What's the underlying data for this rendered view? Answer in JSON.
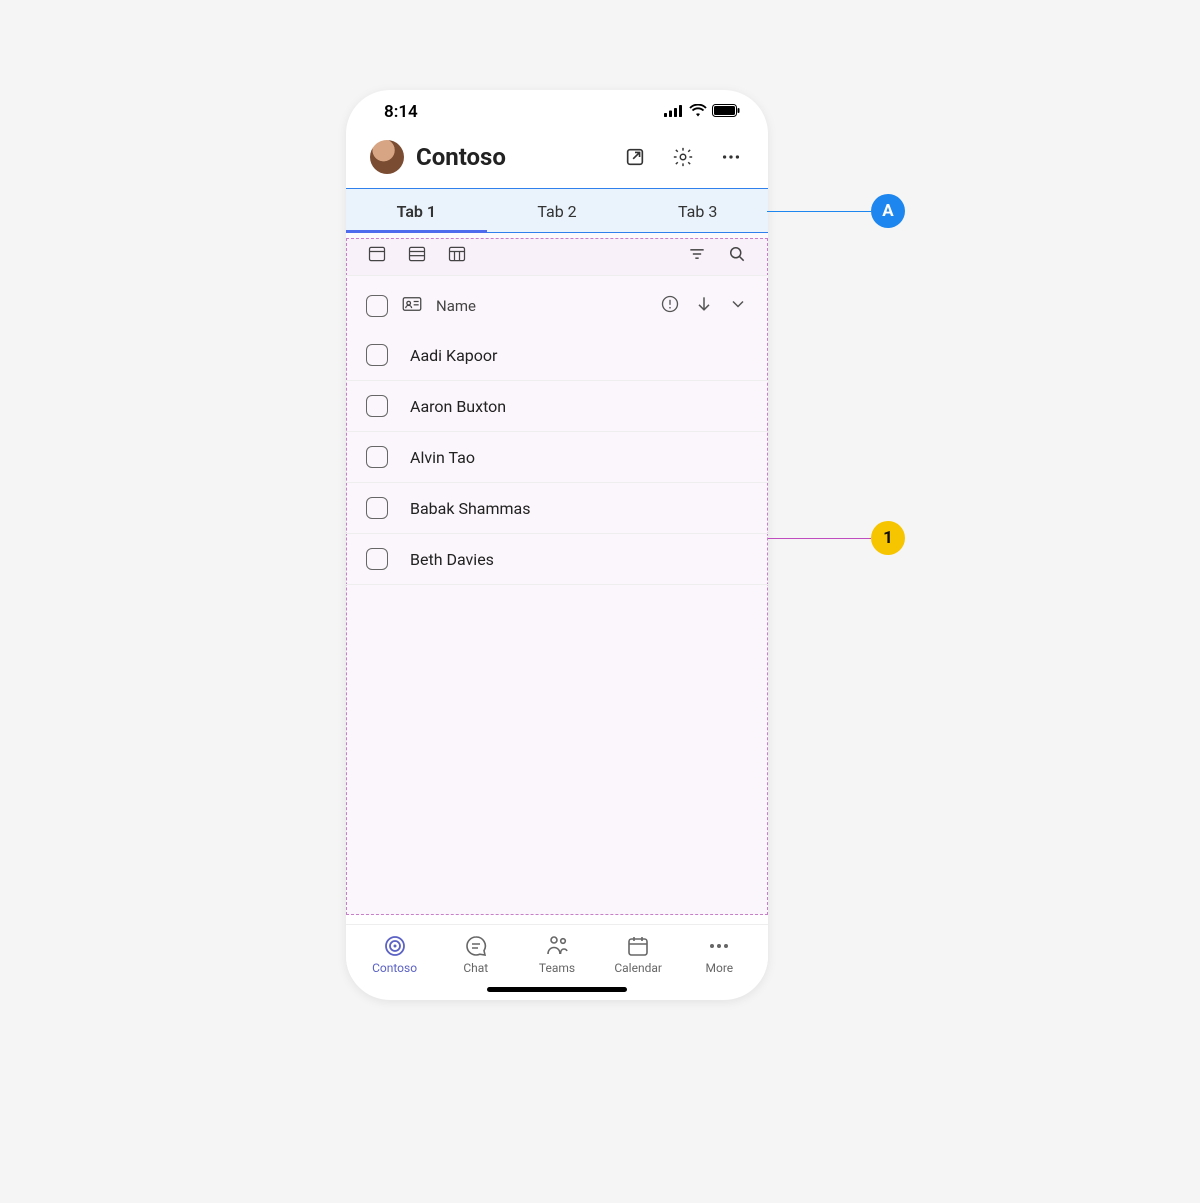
{
  "statusbar": {
    "time": "8:14"
  },
  "header": {
    "title": "Contoso"
  },
  "tabs": {
    "items": [
      "Tab 1",
      "Tab 2",
      "Tab 3"
    ],
    "activeIndex": 0
  },
  "list": {
    "headerLabel": "Name",
    "rows": [
      {
        "name": "Aadi Kapoor"
      },
      {
        "name": "Aaron Buxton"
      },
      {
        "name": "Alvin Tao"
      },
      {
        "name": "Babak Shammas"
      },
      {
        "name": "Beth Davies"
      }
    ]
  },
  "bottomNav": {
    "items": [
      {
        "label": "Contoso"
      },
      {
        "label": "Chat"
      },
      {
        "label": "Teams"
      },
      {
        "label": "Calendar"
      },
      {
        "label": "More"
      }
    ],
    "activeIndex": 0
  },
  "callouts": {
    "a": "A",
    "one": "1"
  }
}
